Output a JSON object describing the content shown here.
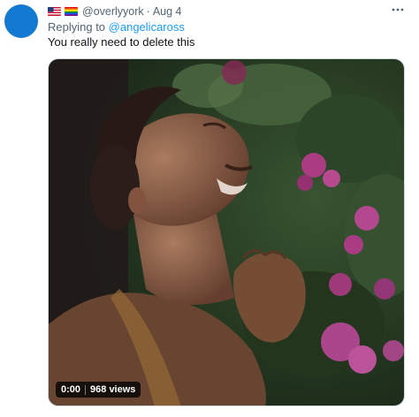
{
  "tweet": {
    "avatar": {
      "color": "#1479d0"
    },
    "flags": [
      {
        "icon": "flag-us-icon"
      },
      {
        "icon": "flag-rainbow-icon"
      }
    ],
    "handle": "@overlyyork",
    "separator": "·",
    "date": "Aug 4",
    "more_icon": "more-horizontal-icon",
    "reply_prefix": "Replying to",
    "reply_mention": "@angelicaross",
    "text": "You really need to delete this",
    "media": {
      "time": "0:00",
      "views": "968 views"
    }
  },
  "colors": {
    "secondary_text": "#536471",
    "link": "#1d9bf0",
    "primary_text": "#0f1419"
  }
}
